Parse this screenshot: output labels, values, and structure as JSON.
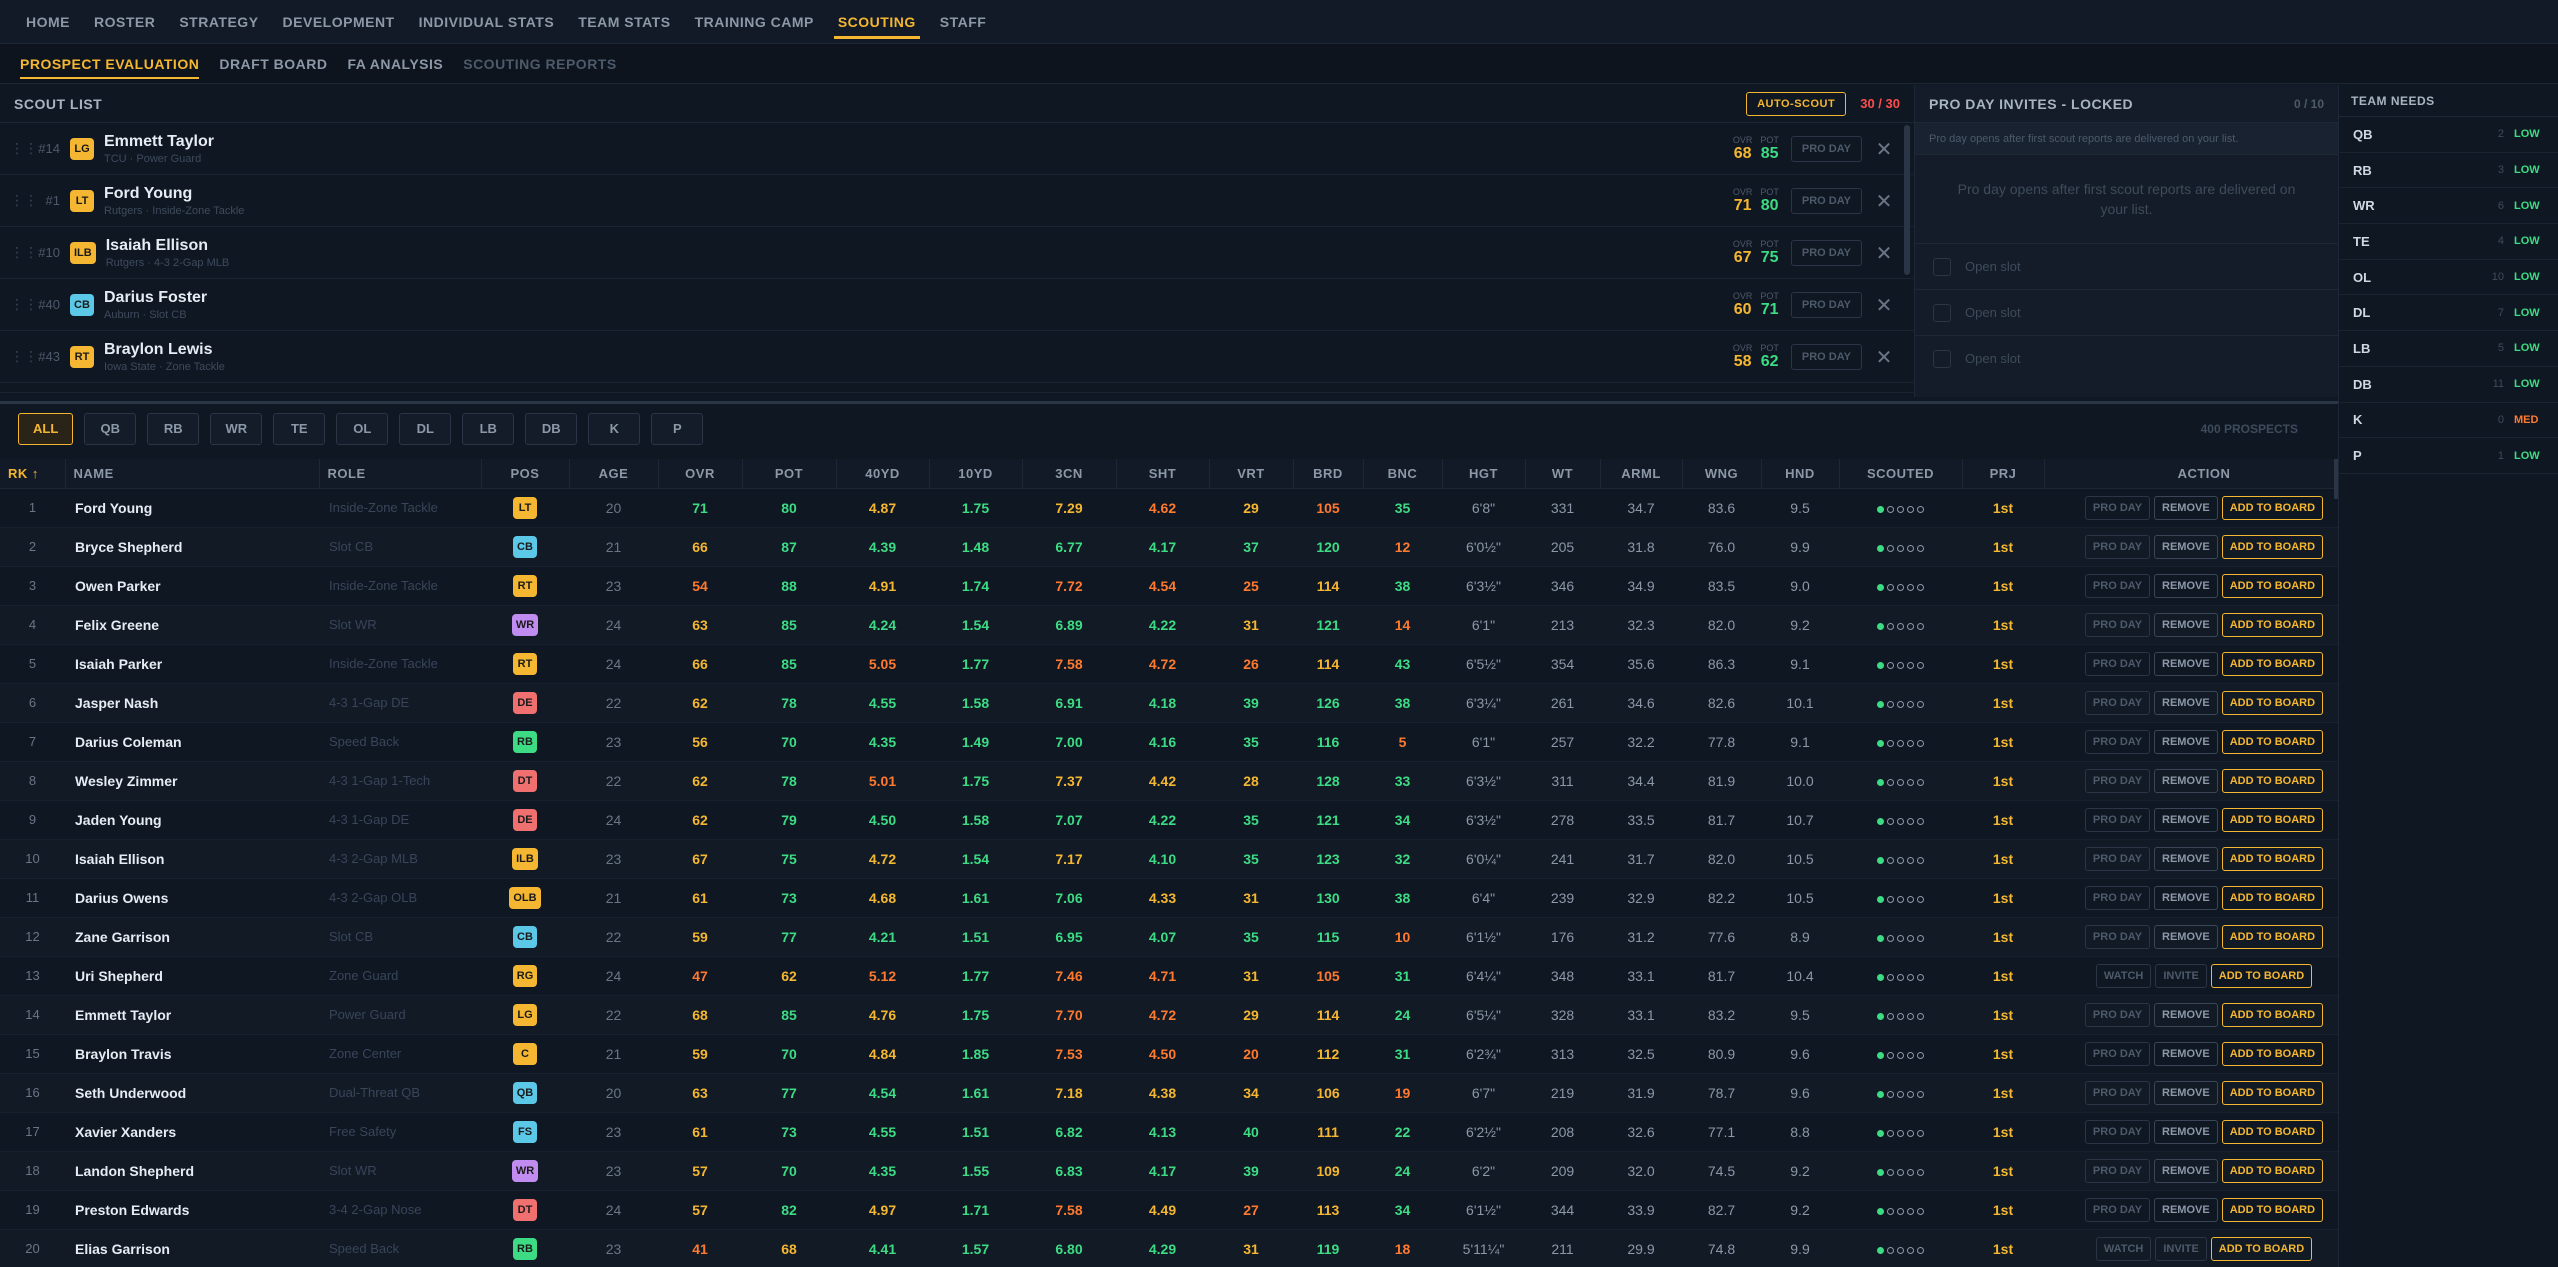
{
  "nav": [
    "HOME",
    "ROSTER",
    "STRATEGY",
    "DEVELOPMENT",
    "INDIVIDUAL STATS",
    "TEAM STATS",
    "TRAINING CAMP",
    "SCOUTING",
    "STAFF"
  ],
  "nav_active": "SCOUTING",
  "subnav": [
    {
      "label": "PROSPECT EVALUATION",
      "state": "active"
    },
    {
      "label": "DRAFT BOARD",
      "state": "normal"
    },
    {
      "label": "FA ANALYSIS",
      "state": "normal"
    },
    {
      "label": "SCOUTING REPORTS",
      "state": "disabled"
    }
  ],
  "scout": {
    "title": "SCOUT LIST",
    "autoscout": "AUTO-SCOUT",
    "count": "30 / 30",
    "ovr_label": "OVR",
    "pot_label": "POT",
    "proday_label": "PRO DAY",
    "rows": [
      {
        "rank": "#14",
        "pos": "LG",
        "name": "Emmett Taylor",
        "sub": "TCU · Power Guard",
        "ovr": "68",
        "pot": "85"
      },
      {
        "rank": "#1",
        "pos": "LT",
        "name": "Ford Young",
        "sub": "Rutgers · Inside-Zone Tackle",
        "ovr": "71",
        "pot": "80"
      },
      {
        "rank": "#10",
        "pos": "ILB",
        "name": "Isaiah Ellison",
        "sub": "Rutgers · 4-3 2-Gap MLB",
        "ovr": "67",
        "pot": "75"
      },
      {
        "rank": "#40",
        "pos": "CB",
        "name": "Darius Foster",
        "sub": "Auburn · Slot CB",
        "ovr": "60",
        "pot": "71"
      },
      {
        "rank": "#43",
        "pos": "RT",
        "name": "Braylon Lewis",
        "sub": "Iowa State · Zone Tackle",
        "ovr": "58",
        "pot": "62"
      }
    ]
  },
  "proday": {
    "title": "PRO DAY INVITES - LOCKED",
    "count": "0 / 10",
    "note": "Pro day opens after first scout reports are delivered on your list.",
    "body": "Pro day opens after first scout reports are delivered on your list.",
    "slots": [
      "Open slot",
      "Open slot",
      "Open slot"
    ]
  },
  "needs": {
    "title": "TEAM NEEDS",
    "rows": [
      {
        "pos": "QB",
        "n": "2",
        "level": "LOW"
      },
      {
        "pos": "RB",
        "n": "3",
        "level": "LOW"
      },
      {
        "pos": "WR",
        "n": "6",
        "level": "LOW"
      },
      {
        "pos": "TE",
        "n": "4",
        "level": "LOW"
      },
      {
        "pos": "OL",
        "n": "10",
        "level": "LOW"
      },
      {
        "pos": "DL",
        "n": "7",
        "level": "LOW"
      },
      {
        "pos": "LB",
        "n": "5",
        "level": "LOW"
      },
      {
        "pos": "DB",
        "n": "11",
        "level": "LOW"
      },
      {
        "pos": "K",
        "n": "0",
        "level": "MED"
      },
      {
        "pos": "P",
        "n": "1",
        "level": "LOW"
      }
    ]
  },
  "filters": [
    "ALL",
    "QB",
    "RB",
    "WR",
    "TE",
    "OL",
    "DL",
    "LB",
    "DB",
    "K",
    "P"
  ],
  "filter_active": "ALL",
  "prospects_count": "400 PROSPECTS",
  "columns": [
    "RK ↑",
    "NAME",
    "ROLE",
    "POS",
    "AGE",
    "OVR",
    "POT",
    "40YD",
    "10YD",
    "3CN",
    "SHT",
    "VRT",
    "BRD",
    "BNC",
    "HGT",
    "WT",
    "ARML",
    "WNG",
    "HND",
    "SCOUTED",
    "PRJ",
    "ACTION"
  ],
  "actions": {
    "proday": "PRO DAY",
    "remove": "REMOVE",
    "add": "ADD TO BOARD",
    "watch": "WATCH",
    "invite": "INVITE"
  },
  "pos_colors": {
    "LT": "#f5b731",
    "RT": "#f5b731",
    "LG": "#f5b731",
    "RG": "#f5b731",
    "C": "#f5b731",
    "CB": "#5bc8e8",
    "FS": "#5bc8e8",
    "WR": "#c08cf0",
    "RB": "#3ddc84",
    "DE": "#f07070",
    "DT": "#f07070",
    "ILB": "#f5b731",
    "OLB": "#f5b731",
    "QB": "#5bc8e8"
  },
  "rows": [
    {
      "rk": "1",
      "name": "Ford Young",
      "role": "Inside-Zone Tackle",
      "pos": "LT",
      "age": "20",
      "ovr": [
        "71",
        "g"
      ],
      "pot": [
        "80",
        "g"
      ],
      "f40": [
        "4.87",
        "y"
      ],
      "f10": [
        "1.75",
        "g"
      ],
      "cn3": [
        "7.29",
        "y"
      ],
      "sht": [
        "4.62",
        "o"
      ],
      "vrt": [
        "29",
        "y"
      ],
      "brd": [
        "105",
        "o"
      ],
      "bnc": [
        "35",
        "g"
      ],
      "hgt": "6'8\"",
      "wt": "331",
      "arml": "34.7",
      "wng": "83.6",
      "hnd": "9.5",
      "scout": 1,
      "prj": "1st",
      "act": "std"
    },
    {
      "rk": "2",
      "name": "Bryce Shepherd",
      "role": "Slot CB",
      "pos": "CB",
      "age": "21",
      "ovr": [
        "66",
        "y"
      ],
      "pot": [
        "87",
        "g"
      ],
      "f40": [
        "4.39",
        "g"
      ],
      "f10": [
        "1.48",
        "g"
      ],
      "cn3": [
        "6.77",
        "g"
      ],
      "sht": [
        "4.17",
        "g"
      ],
      "vrt": [
        "37",
        "g"
      ],
      "brd": [
        "120",
        "g"
      ],
      "bnc": [
        "12",
        "o"
      ],
      "hgt": "6'0½\"",
      "wt": "205",
      "arml": "31.8",
      "wng": "76.0",
      "hnd": "9.9",
      "scout": 1,
      "prj": "1st",
      "act": "std"
    },
    {
      "rk": "3",
      "name": "Owen Parker",
      "role": "Inside-Zone Tackle",
      "pos": "RT",
      "age": "23",
      "ovr": [
        "54",
        "o"
      ],
      "pot": [
        "88",
        "g"
      ],
      "f40": [
        "4.91",
        "y"
      ],
      "f10": [
        "1.74",
        "g"
      ],
      "cn3": [
        "7.72",
        "o"
      ],
      "sht": [
        "4.54",
        "o"
      ],
      "vrt": [
        "25",
        "o"
      ],
      "brd": [
        "114",
        "y"
      ],
      "bnc": [
        "38",
        "g"
      ],
      "hgt": "6'3½\"",
      "wt": "346",
      "arml": "34.9",
      "wng": "83.5",
      "hnd": "9.0",
      "scout": 1,
      "prj": "1st",
      "act": "std"
    },
    {
      "rk": "4",
      "name": "Felix Greene",
      "role": "Slot WR",
      "pos": "WR",
      "age": "24",
      "ovr": [
        "63",
        "y"
      ],
      "pot": [
        "85",
        "g"
      ],
      "f40": [
        "4.24",
        "g"
      ],
      "f10": [
        "1.54",
        "g"
      ],
      "cn3": [
        "6.89",
        "g"
      ],
      "sht": [
        "4.22",
        "g"
      ],
      "vrt": [
        "31",
        "y"
      ],
      "brd": [
        "121",
        "g"
      ],
      "bnc": [
        "14",
        "o"
      ],
      "hgt": "6'1\"",
      "wt": "213",
      "arml": "32.3",
      "wng": "82.0",
      "hnd": "9.2",
      "scout": 1,
      "prj": "1st",
      "act": "std"
    },
    {
      "rk": "5",
      "name": "Isaiah Parker",
      "role": "Inside-Zone Tackle",
      "pos": "RT",
      "age": "24",
      "ovr": [
        "66",
        "y"
      ],
      "pot": [
        "85",
        "g"
      ],
      "f40": [
        "5.05",
        "o"
      ],
      "f10": [
        "1.77",
        "g"
      ],
      "cn3": [
        "7.58",
        "o"
      ],
      "sht": [
        "4.72",
        "o"
      ],
      "vrt": [
        "26",
        "o"
      ],
      "brd": [
        "114",
        "y"
      ],
      "bnc": [
        "43",
        "g"
      ],
      "hgt": "6'5½\"",
      "wt": "354",
      "arml": "35.6",
      "wng": "86.3",
      "hnd": "9.1",
      "scout": 1,
      "prj": "1st",
      "act": "std"
    },
    {
      "rk": "6",
      "name": "Jasper Nash",
      "role": "4-3 1-Gap DE",
      "pos": "DE",
      "age": "22",
      "ovr": [
        "62",
        "y"
      ],
      "pot": [
        "78",
        "g"
      ],
      "f40": [
        "4.55",
        "g"
      ],
      "f10": [
        "1.58",
        "g"
      ],
      "cn3": [
        "6.91",
        "g"
      ],
      "sht": [
        "4.18",
        "g"
      ],
      "vrt": [
        "39",
        "g"
      ],
      "brd": [
        "126",
        "g"
      ],
      "bnc": [
        "38",
        "g"
      ],
      "hgt": "6'3¼\"",
      "wt": "261",
      "arml": "34.6",
      "wng": "82.6",
      "hnd": "10.1",
      "scout": 1,
      "prj": "1st",
      "act": "std"
    },
    {
      "rk": "7",
      "name": "Darius Coleman",
      "role": "Speed Back",
      "pos": "RB",
      "age": "23",
      "ovr": [
        "56",
        "y"
      ],
      "pot": [
        "70",
        "g"
      ],
      "f40": [
        "4.35",
        "g"
      ],
      "f10": [
        "1.49",
        "g"
      ],
      "cn3": [
        "7.00",
        "g"
      ],
      "sht": [
        "4.16",
        "g"
      ],
      "vrt": [
        "35",
        "g"
      ],
      "brd": [
        "116",
        "g"
      ],
      "bnc": [
        "5",
        "o"
      ],
      "hgt": "6'1\"",
      "wt": "257",
      "arml": "32.2",
      "wng": "77.8",
      "hnd": "9.1",
      "scout": 1,
      "prj": "1st",
      "act": "std"
    },
    {
      "rk": "8",
      "name": "Wesley Zimmer",
      "role": "4-3 1-Gap 1-Tech",
      "pos": "DT",
      "age": "22",
      "ovr": [
        "62",
        "y"
      ],
      "pot": [
        "78",
        "g"
      ],
      "f40": [
        "5.01",
        "o"
      ],
      "f10": [
        "1.75",
        "g"
      ],
      "cn3": [
        "7.37",
        "y"
      ],
      "sht": [
        "4.42",
        "y"
      ],
      "vrt": [
        "28",
        "y"
      ],
      "brd": [
        "128",
        "g"
      ],
      "bnc": [
        "33",
        "g"
      ],
      "hgt": "6'3½\"",
      "wt": "311",
      "arml": "34.4",
      "wng": "81.9",
      "hnd": "10.0",
      "scout": 1,
      "prj": "1st",
      "act": "std"
    },
    {
      "rk": "9",
      "name": "Jaden Young",
      "role": "4-3 1-Gap DE",
      "pos": "DE",
      "age": "24",
      "ovr": [
        "62",
        "y"
      ],
      "pot": [
        "79",
        "g"
      ],
      "f40": [
        "4.50",
        "g"
      ],
      "f10": [
        "1.58",
        "g"
      ],
      "cn3": [
        "7.07",
        "g"
      ],
      "sht": [
        "4.22",
        "g"
      ],
      "vrt": [
        "35",
        "g"
      ],
      "brd": [
        "121",
        "g"
      ],
      "bnc": [
        "34",
        "g"
      ],
      "hgt": "6'3½\"",
      "wt": "278",
      "arml": "33.5",
      "wng": "81.7",
      "hnd": "10.7",
      "scout": 1,
      "prj": "1st",
      "act": "std"
    },
    {
      "rk": "10",
      "name": "Isaiah Ellison",
      "role": "4-3 2-Gap MLB",
      "pos": "ILB",
      "age": "23",
      "ovr": [
        "67",
        "y"
      ],
      "pot": [
        "75",
        "g"
      ],
      "f40": [
        "4.72",
        "y"
      ],
      "f10": [
        "1.54",
        "g"
      ],
      "cn3": [
        "7.17",
        "y"
      ],
      "sht": [
        "4.10",
        "g"
      ],
      "vrt": [
        "35",
        "g"
      ],
      "brd": [
        "123",
        "g"
      ],
      "bnc": [
        "32",
        "g"
      ],
      "hgt": "6'0¼\"",
      "wt": "241",
      "arml": "31.7",
      "wng": "82.0",
      "hnd": "10.5",
      "scout": 1,
      "prj": "1st",
      "act": "std"
    },
    {
      "rk": "11",
      "name": "Darius Owens",
      "role": "4-3 2-Gap OLB",
      "pos": "OLB",
      "age": "21",
      "ovr": [
        "61",
        "y"
      ],
      "pot": [
        "73",
        "g"
      ],
      "f40": [
        "4.68",
        "y"
      ],
      "f10": [
        "1.61",
        "g"
      ],
      "cn3": [
        "7.06",
        "g"
      ],
      "sht": [
        "4.33",
        "y"
      ],
      "vrt": [
        "31",
        "y"
      ],
      "brd": [
        "130",
        "g"
      ],
      "bnc": [
        "38",
        "g"
      ],
      "hgt": "6'4\"",
      "wt": "239",
      "arml": "32.9",
      "wng": "82.2",
      "hnd": "10.5",
      "scout": 1,
      "prj": "1st",
      "act": "std"
    },
    {
      "rk": "12",
      "name": "Zane Garrison",
      "role": "Slot CB",
      "pos": "CB",
      "age": "22",
      "ovr": [
        "59",
        "y"
      ],
      "pot": [
        "77",
        "g"
      ],
      "f40": [
        "4.21",
        "g"
      ],
      "f10": [
        "1.51",
        "g"
      ],
      "cn3": [
        "6.95",
        "g"
      ],
      "sht": [
        "4.07",
        "g"
      ],
      "vrt": [
        "35",
        "g"
      ],
      "brd": [
        "115",
        "g"
      ],
      "bnc": [
        "10",
        "o"
      ],
      "hgt": "6'1½\"",
      "wt": "176",
      "arml": "31.2",
      "wng": "77.6",
      "hnd": "8.9",
      "scout": 1,
      "prj": "1st",
      "act": "std"
    },
    {
      "rk": "13",
      "name": "Uri Shepherd",
      "role": "Zone Guard",
      "pos": "RG",
      "age": "24",
      "ovr": [
        "47",
        "o"
      ],
      "pot": [
        "62",
        "y"
      ],
      "f40": [
        "5.12",
        "o"
      ],
      "f10": [
        "1.77",
        "g"
      ],
      "cn3": [
        "7.46",
        "o"
      ],
      "sht": [
        "4.71",
        "o"
      ],
      "vrt": [
        "31",
        "y"
      ],
      "brd": [
        "105",
        "o"
      ],
      "bnc": [
        "31",
        "g"
      ],
      "hgt": "6'4¼\"",
      "wt": "348",
      "arml": "33.1",
      "wng": "81.7",
      "hnd": "10.4",
      "scout": 1,
      "prj": "1st",
      "act": "watch"
    },
    {
      "rk": "14",
      "name": "Emmett Taylor",
      "role": "Power Guard",
      "pos": "LG",
      "age": "22",
      "ovr": [
        "68",
        "y"
      ],
      "pot": [
        "85",
        "g"
      ],
      "f40": [
        "4.76",
        "y"
      ],
      "f10": [
        "1.75",
        "g"
      ],
      "cn3": [
        "7.70",
        "o"
      ],
      "sht": [
        "4.72",
        "o"
      ],
      "vrt": [
        "29",
        "y"
      ],
      "brd": [
        "114",
        "y"
      ],
      "bnc": [
        "24",
        "g"
      ],
      "hgt": "6'5¼\"",
      "wt": "328",
      "arml": "33.1",
      "wng": "83.2",
      "hnd": "9.5",
      "scout": 1,
      "prj": "1st",
      "act": "std"
    },
    {
      "rk": "15",
      "name": "Braylon Travis",
      "role": "Zone Center",
      "pos": "C",
      "age": "21",
      "ovr": [
        "59",
        "y"
      ],
      "pot": [
        "70",
        "g"
      ],
      "f40": [
        "4.84",
        "y"
      ],
      "f10": [
        "1.85",
        "g"
      ],
      "cn3": [
        "7.53",
        "o"
      ],
      "sht": [
        "4.50",
        "o"
      ],
      "vrt": [
        "20",
        "o"
      ],
      "brd": [
        "112",
        "y"
      ],
      "bnc": [
        "31",
        "g"
      ],
      "hgt": "6'2¾\"",
      "wt": "313",
      "arml": "32.5",
      "wng": "80.9",
      "hnd": "9.6",
      "scout": 1,
      "prj": "1st",
      "act": "std"
    },
    {
      "rk": "16",
      "name": "Seth Underwood",
      "role": "Dual-Threat QB",
      "pos": "QB",
      "age": "20",
      "ovr": [
        "63",
        "y"
      ],
      "pot": [
        "77",
        "g"
      ],
      "f40": [
        "4.54",
        "g"
      ],
      "f10": [
        "1.61",
        "g"
      ],
      "cn3": [
        "7.18",
        "y"
      ],
      "sht": [
        "4.38",
        "y"
      ],
      "vrt": [
        "34",
        "y"
      ],
      "brd": [
        "106",
        "y"
      ],
      "bnc": [
        "19",
        "o"
      ],
      "hgt": "6'7\"",
      "wt": "219",
      "arml": "31.9",
      "wng": "78.7",
      "hnd": "9.6",
      "scout": 1,
      "prj": "1st",
      "act": "std"
    },
    {
      "rk": "17",
      "name": "Xavier Xanders",
      "role": "Free Safety",
      "pos": "FS",
      "age": "23",
      "ovr": [
        "61",
        "y"
      ],
      "pot": [
        "73",
        "g"
      ],
      "f40": [
        "4.55",
        "g"
      ],
      "f10": [
        "1.51",
        "g"
      ],
      "cn3": [
        "6.82",
        "g"
      ],
      "sht": [
        "4.13",
        "g"
      ],
      "vrt": [
        "40",
        "g"
      ],
      "brd": [
        "111",
        "y"
      ],
      "bnc": [
        "22",
        "g"
      ],
      "hgt": "6'2½\"",
      "wt": "208",
      "arml": "32.6",
      "wng": "77.1",
      "hnd": "8.8",
      "scout": 1,
      "prj": "1st",
      "act": "std"
    },
    {
      "rk": "18",
      "name": "Landon Shepherd",
      "role": "Slot WR",
      "pos": "WR",
      "age": "23",
      "ovr": [
        "57",
        "y"
      ],
      "pot": [
        "70",
        "g"
      ],
      "f40": [
        "4.35",
        "g"
      ],
      "f10": [
        "1.55",
        "g"
      ],
      "cn3": [
        "6.83",
        "g"
      ],
      "sht": [
        "4.17",
        "g"
      ],
      "vrt": [
        "39",
        "g"
      ],
      "brd": [
        "109",
        "y"
      ],
      "bnc": [
        "24",
        "g"
      ],
      "hgt": "6'2\"",
      "wt": "209",
      "arml": "32.0",
      "wng": "74.5",
      "hnd": "9.2",
      "scout": 1,
      "prj": "1st",
      "act": "std"
    },
    {
      "rk": "19",
      "name": "Preston Edwards",
      "role": "3-4 2-Gap Nose",
      "pos": "DT",
      "age": "24",
      "ovr": [
        "57",
        "y"
      ],
      "pot": [
        "82",
        "g"
      ],
      "f40": [
        "4.97",
        "y"
      ],
      "f10": [
        "1.71",
        "g"
      ],
      "cn3": [
        "7.58",
        "o"
      ],
      "sht": [
        "4.49",
        "y"
      ],
      "vrt": [
        "27",
        "o"
      ],
      "brd": [
        "113",
        "y"
      ],
      "bnc": [
        "34",
        "g"
      ],
      "hgt": "6'1½\"",
      "wt": "344",
      "arml": "33.9",
      "wng": "82.7",
      "hnd": "9.2",
      "scout": 1,
      "prj": "1st",
      "act": "std"
    },
    {
      "rk": "20",
      "name": "Elias Garrison",
      "role": "Speed Back",
      "pos": "RB",
      "age": "23",
      "ovr": [
        "41",
        "o"
      ],
      "pot": [
        "68",
        "y"
      ],
      "f40": [
        "4.41",
        "g"
      ],
      "f10": [
        "1.57",
        "g"
      ],
      "cn3": [
        "6.80",
        "g"
      ],
      "sht": [
        "4.29",
        "g"
      ],
      "vrt": [
        "31",
        "y"
      ],
      "brd": [
        "119",
        "g"
      ],
      "bnc": [
        "18",
        "o"
      ],
      "hgt": "5'11¼\"",
      "wt": "211",
      "arml": "29.9",
      "wng": "74.8",
      "hnd": "9.9",
      "scout": 1,
      "prj": "1st",
      "act": "watch"
    }
  ]
}
